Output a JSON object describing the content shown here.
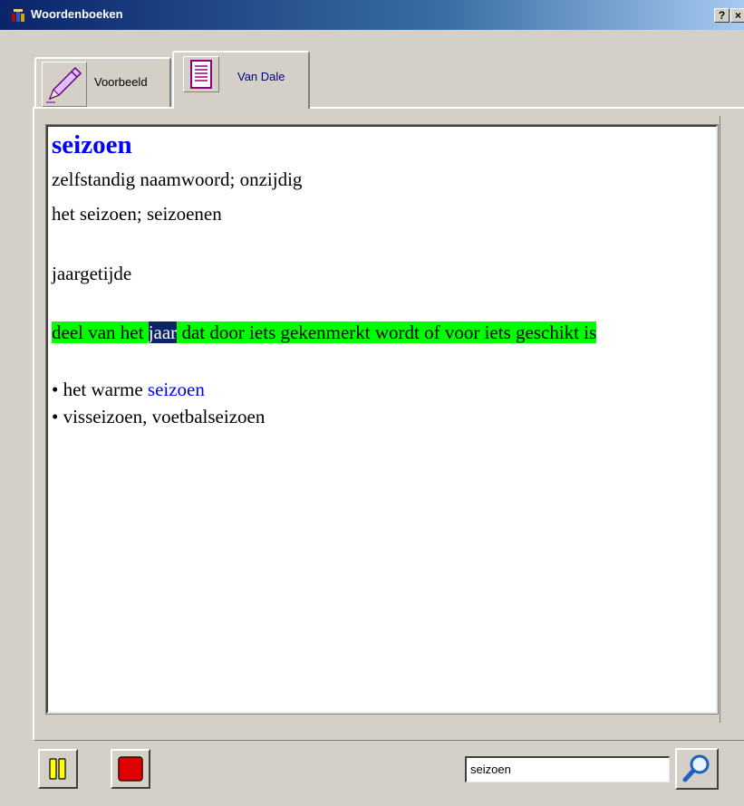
{
  "window": {
    "title": "Woordenboeken",
    "help_label": "?",
    "close_label": "×"
  },
  "tabs": [
    {
      "label": "Voorbeeld",
      "icon": "pencil-icon",
      "active": false
    },
    {
      "label": "Van Dale",
      "icon": "document-icon",
      "active": true
    }
  ],
  "entry": {
    "word": "seizoen",
    "grammar": "zelfstandig naamwoord; onzijdig",
    "forms": "het seizoen; seizoenen",
    "synonym": "jaargetijde",
    "definition_before": "deel van het ",
    "definition_selected": "jaar",
    "definition_after": " dat door iets gekenmerkt wordt of voor iets geschikt is",
    "example1_prefix": "• het warme ",
    "example1_word": "seizoen",
    "example2": "• visseizoen, voetbalseizoen"
  },
  "search": {
    "value": "seizoen"
  },
  "colors": {
    "highlight": "#00ff00",
    "selection": "#0a246a",
    "link_blue": "#0000ff"
  }
}
